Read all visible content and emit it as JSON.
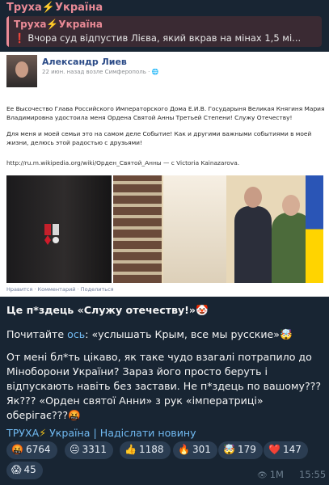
{
  "channel": {
    "name": "Труха⚡️Україна"
  },
  "reply": {
    "title": "Труха⚡️Україна",
    "mark": "❗️",
    "text": "Вчора суд відпустив Лієва, який вкрав на мінах 1,5 мі..."
  },
  "facebook_post": {
    "author": "Александр Лиев",
    "meta": "22 июн. назад возле Симферополь · 🌐",
    "paragraph1": "Ее Высочество Глава Российского Императорского Дома Е.И.В. Государыня Великая Княгиня Мария Владимировна удостоила меня Ордена Святой Анны Третьей Степени! Служу Отечеству!",
    "paragraph2": "Для меня и моей семьи это на самом деле Событие! Как и другими важными событиями в моей жизни, делюсь этой радостью с друзьями!",
    "link": "http://ru.m.wikipedia.org/wiki/Орден_Святой_Анны — с Victoria Kainazarova.",
    "actions": "Нравится · Комментарий · Поделиться"
  },
  "caption": {
    "line1": "Це п*здець «Служу отечеству!»🤡",
    "line2_prefix": "Почитайте ",
    "line2_link": "ось",
    "line2_suffix": ": «услышать Крым, все мы русские»🤯",
    "paragraph3": "От мені бл*ть цікаво, як таке чудо взагалі потрапило до Міноборони України? Зараз його просто беруть і відпускають навіть без застави. Не п*здець по вашому??? Як??? «Орден святої Анни» з рук «імператриці» оберігає???🤬"
  },
  "footer": {
    "channel_prefix": "ТРУХА",
    "bolt": "⚡",
    "channel_suffix": " Україна | Надіслати новину"
  },
  "reactions": [
    {
      "emoji": "🤬",
      "count": "6764"
    },
    {
      "emoji": "😐",
      "count": "3311"
    },
    {
      "emoji": "👍",
      "count": "1188"
    },
    {
      "emoji": "🔥",
      "count": "301"
    },
    {
      "emoji": "🤯",
      "count": "179"
    },
    {
      "emoji": "❤️",
      "count": "147"
    },
    {
      "emoji": "😱",
      "count": "45"
    }
  ],
  "meta": {
    "views": "1M",
    "time": "15:55"
  },
  "colors": {
    "accent": "#e98a96",
    "link": "#71baf2",
    "bubble": "#182533"
  }
}
